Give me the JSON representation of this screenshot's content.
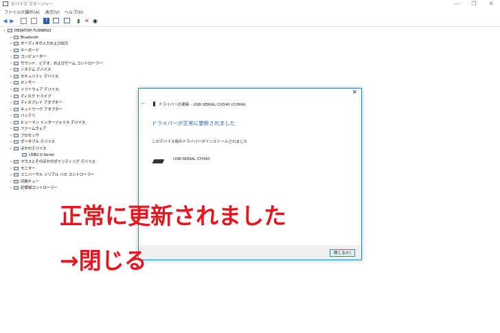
{
  "window": {
    "title": "デバイス マネージャー",
    "controls": [
      "—",
      "❐",
      "✕"
    ]
  },
  "menu": [
    "ファイル(F)",
    "操作(A)",
    "表示(V)",
    "ヘルプ(H)"
  ],
  "toolbar": {
    "buttons": [
      "back-icon",
      "forward-icon",
      "properties-icon",
      "view-icon",
      "help-icon",
      "monitor-icon",
      "scan-icon",
      "update-icon",
      "uninstall-icon",
      "disable-icon"
    ]
  },
  "tree": {
    "root": "DESKTOP-7U3N8GQ",
    "items": [
      {
        "label": "Bluetooth",
        "exp": ">"
      },
      {
        "label": "オーディオの入力および出力",
        "exp": ">"
      },
      {
        "label": "キーボード",
        "exp": ">"
      },
      {
        "label": "コンピューター",
        "exp": ">"
      },
      {
        "label": "サウンド、ビデオ、およびゲーム コントローラー",
        "exp": ">"
      },
      {
        "label": "システム デバイス",
        "exp": ">"
      },
      {
        "label": "セキュリティ デバイス",
        "exp": ">"
      },
      {
        "label": "センサー",
        "exp": ">"
      },
      {
        "label": "ソフトウェア デバイス",
        "exp": ">"
      },
      {
        "label": "ディスク ドライブ",
        "exp": ">"
      },
      {
        "label": "ディスプレイ アダプター",
        "exp": ">"
      },
      {
        "label": "ネットワーク アダプター",
        "exp": ">"
      },
      {
        "label": "バッテリ",
        "exp": ">"
      },
      {
        "label": "ヒューマン インターフェイス デバイス",
        "exp": ">"
      },
      {
        "label": "ファームウェア",
        "exp": ">"
      },
      {
        "label": "プロセッサ",
        "exp": ">"
      },
      {
        "label": "ポータブル デバイス",
        "exp": ">"
      },
      {
        "label": "ほかのデバイス",
        "exp": "v"
      },
      {
        "label": "USB2.0-Serial",
        "exp": "",
        "child": true
      },
      {
        "label": "マウスとそのほかのポインティング デバイス",
        "exp": ">"
      },
      {
        "label": "モニター",
        "exp": ">"
      },
      {
        "label": "ユニバーサル シリアル バス コントローラー",
        "exp": ">"
      },
      {
        "label": "印刷キュー",
        "exp": ">"
      },
      {
        "label": "記憶域コントローラー",
        "exp": ">"
      }
    ]
  },
  "dialog": {
    "close": "✕",
    "back": "←",
    "title": "ドライバーの更新 - USB-SERIAL CH340 (COM4)",
    "heading": "ドライバーが正常に更新されました",
    "message": "このデバイス用のドライバーがインストールされました",
    "device_name": "USB-SERIAL CH340",
    "close_button": "閉じる(C)"
  },
  "annotation": {
    "line1": "正常に更新されました",
    "line2": "→閉じる",
    "color": "#e8141e"
  }
}
